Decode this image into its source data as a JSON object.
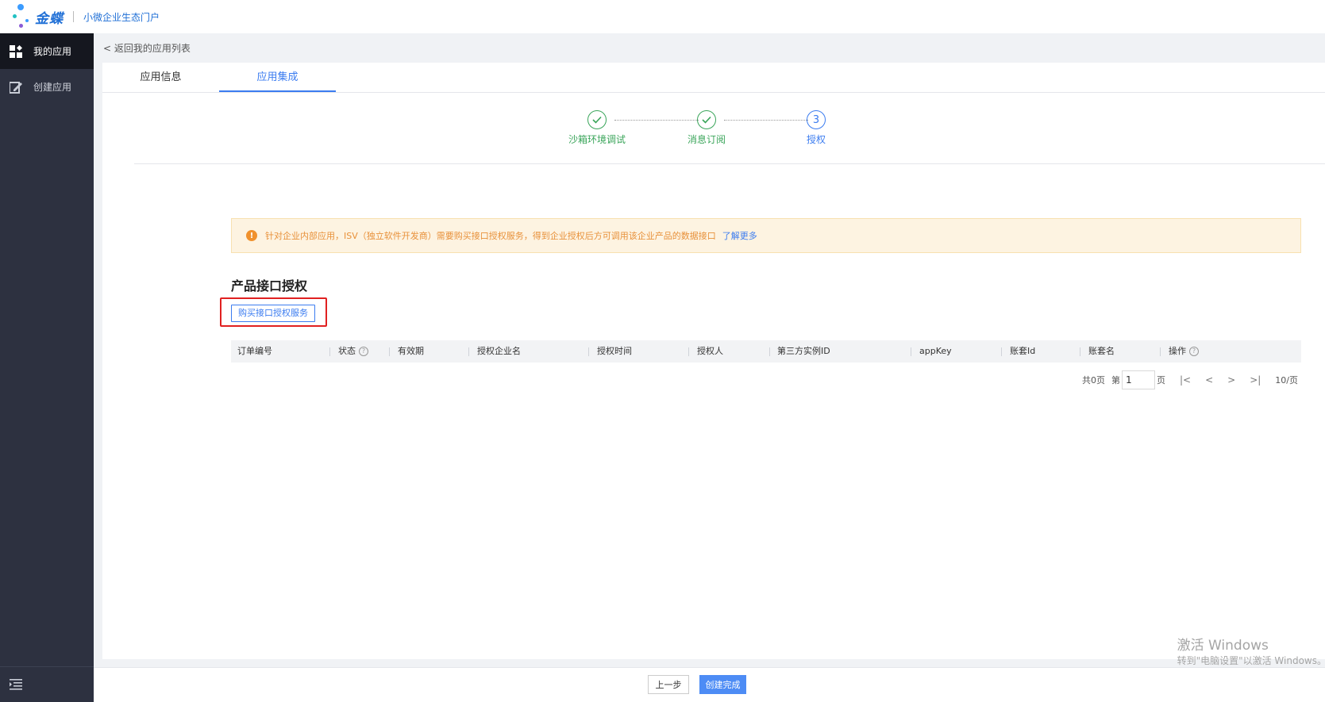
{
  "brand": {
    "name": "金蝶",
    "subtitle": "小微企业生态门户"
  },
  "sidebar": {
    "items": [
      {
        "label": "我的应用",
        "icon": "grid-icon",
        "active": true
      },
      {
        "label": "创建应用",
        "icon": "edit-icon",
        "active": false
      }
    ],
    "footer_icon": "collapse-menu-icon"
  },
  "back_link": "< 返回我的应用列表",
  "tabs": [
    {
      "label": "应用信息",
      "active": false
    },
    {
      "label": "应用集成",
      "active": true
    }
  ],
  "steps": [
    {
      "label": "沙箱环境调试",
      "status": "done"
    },
    {
      "label": "消息订阅",
      "status": "done"
    },
    {
      "label": "授权",
      "status": "current",
      "number": "3"
    }
  ],
  "alert": {
    "text": "针对企业内部应用，ISV（独立软件开发商）需要购买接口授权服务，得到企业授权后方可调用该企业产品的数据接口",
    "link": "了解更多"
  },
  "section_title": "产品接口授权",
  "buy_button": "购买接口授权服务",
  "table": {
    "columns": [
      "订单编号",
      "状态",
      "有效期",
      "授权企业名",
      "授权时间",
      "授权人",
      "第三方实例ID",
      "appKey",
      "账套Id",
      "账套名",
      "操作"
    ],
    "rows": []
  },
  "pager": {
    "total": "共0页",
    "page_prefix": "第",
    "page": "1",
    "page_suffix": "页",
    "first": "|<",
    "prev": "<",
    "next": ">",
    "last": ">|",
    "page_size": "10/页"
  },
  "footer": {
    "prev_label": "上一步",
    "finish_label": "创建完成"
  },
  "watermark": {
    "line1": "激活 Windows",
    "line2": "转到\"电脑设置\"以激活 Windows。"
  },
  "colors": {
    "primary": "#3b7cf0",
    "success": "#3aa55a",
    "warning": "#f0912d",
    "sidebar_bg": "#2d3140",
    "highlight": "#e02020"
  }
}
